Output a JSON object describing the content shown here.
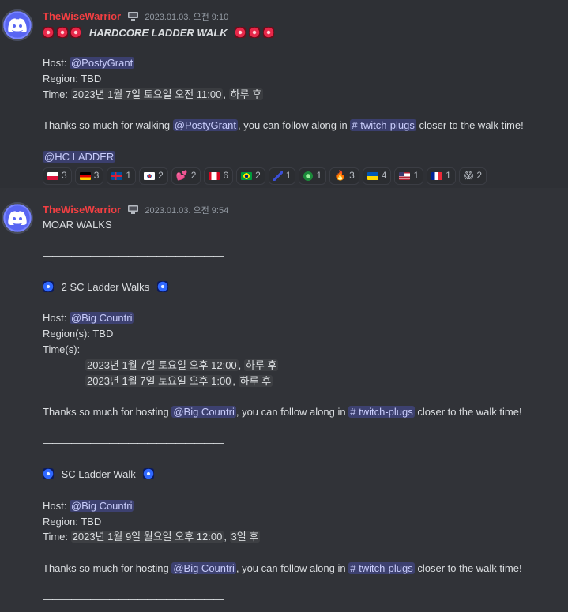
{
  "messages": [
    {
      "username": "TheWiseWarrior",
      "timestamp": "2023.01.03. 오전 9:10",
      "title": "HARDCORE LADDER WALK",
      "host_label": "Host:",
      "host": "@PostyGrant",
      "region_label": "Region:",
      "region": "TBD",
      "time_label": "Time:",
      "time": "2023년 1월 7일 토요일 오전 11:00",
      "time_rel": "하루 후",
      "thanks_pre": "Thanks so much for walking",
      "thanks_mention": "@PostyGrant",
      "thanks_mid": ", you can follow along in",
      "thanks_channel": "twitch-plugs",
      "thanks_post": "closer to the walk time!",
      "role_mention": "@HC LADDER",
      "reactions": [
        {
          "icon": "flag-poland",
          "count": "3"
        },
        {
          "icon": "flag-germany",
          "count": "3"
        },
        {
          "icon": "flag-iceland",
          "count": "1"
        },
        {
          "icon": "flag-south-korea",
          "count": "2"
        },
        {
          "icon": "hearts-icon",
          "count": "2"
        },
        {
          "icon": "flag-canada",
          "count": "6"
        },
        {
          "icon": "flag-brazil",
          "count": "2"
        },
        {
          "icon": "custom-emoji-icon",
          "count": "1"
        },
        {
          "icon": "custom-green-emoji-icon",
          "count": "1"
        },
        {
          "icon": "fire-icon",
          "count": "3"
        },
        {
          "icon": "flag-ukraine",
          "count": "4"
        },
        {
          "icon": "flag-usa",
          "count": "1"
        },
        {
          "icon": "flag-france",
          "count": "1"
        },
        {
          "icon": "scream-icon",
          "count": "2"
        }
      ]
    },
    {
      "username": "TheWiseWarrior",
      "timestamp": "2023.01.03. 오전 9:54",
      "intro": "MOAR WALKS",
      "rule": "———————————————————",
      "section1_title": "2 SC Ladder Walks",
      "host_label": "Host:",
      "host": "@Big Countri",
      "region_label": "Region(s):",
      "region": "TBD",
      "times_label": "Time(s):",
      "time1": "2023년 1월 7일 토요일 오후 12:00",
      "time1_rel": "하루 후",
      "time2": "2023년 1월 7일 토요일 오후 1:00",
      "time2_rel": "하루 후",
      "thanks_pre": "Thanks so much for hosting",
      "thanks_mention": "@Big Countri",
      "thanks_mid": ", you can follow along in",
      "thanks_channel": "twitch-plugs",
      "thanks_post": "closer to the walk time!",
      "section2_title": "SC Ladder Walk",
      "host2_label": "Host:",
      "host2": "@Big Countri",
      "region2_label": "Region:",
      "region2": "TBD",
      "time3_label": "Time:",
      "time3": "2023년 1월 9일 월요일 오후 12:00",
      "time3_rel": "3일 후"
    }
  ],
  "colors": {
    "background": "#313338",
    "username": "#f23f42",
    "mention_bg": "#4a4f8f",
    "timestamp": "#949ba4"
  }
}
